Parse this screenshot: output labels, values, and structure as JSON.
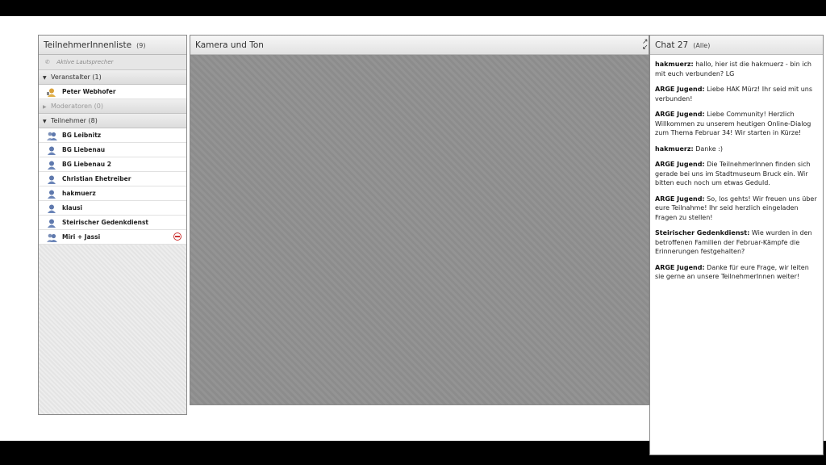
{
  "attendees": {
    "title": "TeilnehmerInnenliste",
    "count": "(9)",
    "active_speaker": "Aktive Lautsprecher",
    "hosts": {
      "label": "Veranstalter (1)",
      "people": [
        "Peter Webhofer"
      ]
    },
    "presenters": {
      "label": "Moderatoren (0)"
    },
    "participants": {
      "label": "Teilnehmer (8)",
      "people": [
        "BG Leibnitz",
        "BG Liebenau",
        "BG Liebenau 2",
        "Christian Ehetreiber",
        "hakmuerz",
        "klausi",
        "Steirischer Gedenkdienst",
        "Miri + Jassi"
      ]
    }
  },
  "camera": {
    "title": "Kamera und Ton"
  },
  "chat": {
    "title": "Chat 27",
    "filter": "(Alle)",
    "messages": [
      {
        "sender": "hakmuerz:",
        "text": "hallo, hier ist die hakmuerz - bin ich mit euch verbunden? LG"
      },
      {
        "sender": "ARGE Jugend:",
        "text": "Liebe HAK Mürz! Ihr seid mit uns verbunden!"
      },
      {
        "sender": "ARGE Jugend:",
        "text": "Liebe Community! Herzlich Willkommen zu unserem heutigen Online-Dialog zum Thema Februar 34! Wir starten in Kürze!"
      },
      {
        "sender": "hakmuerz:",
        "text": "Danke :)"
      },
      {
        "sender": "ARGE Jugend:",
        "text": "Die TeilnehmerInnen finden sich gerade bei uns im Stadtmuseum Bruck ein. Wir bitten euch noch um etwas Geduld."
      },
      {
        "sender": "ARGE Jugend:",
        "text": "So, los gehts! Wir freuen uns über eure Teilnahme! Ihr seid herzlich eingeladen Fragen zu stellen!"
      },
      {
        "sender": "Steirischer Gedenkdienst:",
        "text": "Wie wurden in den betroffenen Familien der Februar-Kämpfe die Erinnerungen festgehalten?"
      },
      {
        "sender": "ARGE Jugend:",
        "text": "Danke für eure Frage, wir leiten sie gerne an unsere TeilnehmerInnen weiter!"
      }
    ]
  }
}
